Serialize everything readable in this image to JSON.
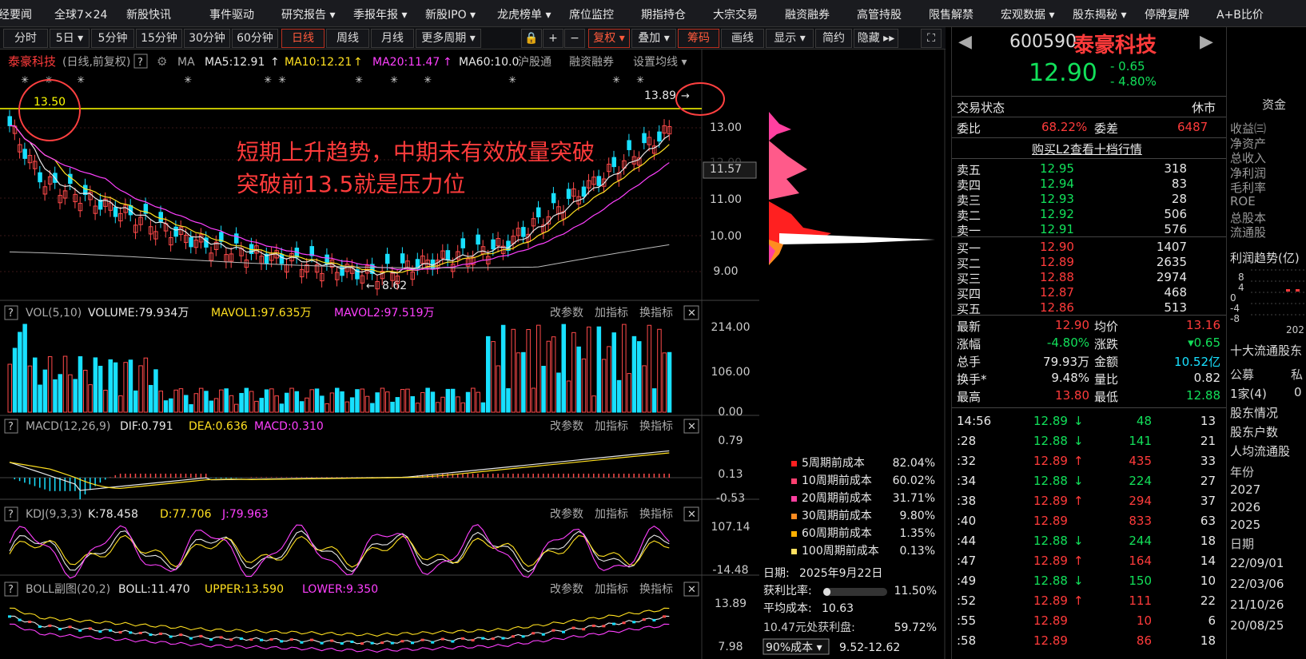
{
  "top_nav": [
    "经要闻",
    "全球7×24",
    "新股快讯",
    "事件驱动",
    "研究报告 ▾",
    "季报年报 ▾",
    "新股IPO ▾",
    "龙虎榜单 ▾",
    "席位监控",
    "期指持仓",
    "大宗交易",
    "融资融券",
    "高管持股",
    "限售解禁",
    "宏观数据 ▾",
    "股东揭秘 ▾",
    "停牌复牌",
    "A+B比价"
  ],
  "toolbar": {
    "periods": [
      "分时",
      "5日 ▾",
      "5分钟",
      "15分钟",
      "30分钟",
      "60分钟",
      "日线",
      "周线",
      "月线",
      "更多周期 ▾"
    ],
    "active_period": "日线",
    "tools": [
      "复权 ▾",
      "叠加 ▾",
      "筹码",
      "画线",
      "显示 ▾",
      "简约",
      "隐藏 ▸▸"
    ]
  },
  "stock": {
    "code": "600590",
    "name": "泰豪科技",
    "price": "12.90",
    "change": "- 0.65",
    "pct": "- 4.80%"
  },
  "main_chart": {
    "title": "泰豪科技",
    "subtitle": "(日线,前复权)",
    "q": "?",
    "ma_label": "MA",
    "ma5": "MA5:12.91",
    "ma10": "MA10:12.21",
    "ma20": "MA20:11.47",
    "ma60": "MA60:10.0",
    "links": [
      "沪股通",
      "融资融券",
      "设置均线 ▾"
    ],
    "price_ticks": [
      "13.00",
      "12.00",
      "11.57",
      "11.00",
      "10.00",
      "9.00"
    ],
    "label_1350": "13.50",
    "label_1389": "13.89",
    "label_862": "8.62",
    "annotation_line1": "短期上升趋势，中期未有效放量突破",
    "annotation_line2": "突破前13.5就是压力位"
  },
  "panels": {
    "vol": {
      "q": "?",
      "name": "VOL(5,10)",
      "v1": "VOLUME:79.934万",
      "v2": "MAVOL1:97.635万",
      "v3": "MAVOL2:97.519万",
      "ticks": [
        "214.00",
        "106.00",
        "0.00"
      ]
    },
    "macd": {
      "q": "?",
      "name": "MACD(12,26,9)",
      "v1": "DIF:0.791",
      "v2": "DEA:0.636",
      "v3": "MACD:0.310",
      "ticks": [
        "0.79",
        "0.13",
        "-0.53"
      ]
    },
    "kdj": {
      "q": "?",
      "name": "KDJ(9,3,3)",
      "v1": "K:78.458",
      "v2": "D:77.706",
      "v3": "J:79.963",
      "ticks": [
        "107.14",
        "-14.48"
      ]
    },
    "boll": {
      "q": "?",
      "name": "BOLL副图(20,2)",
      "v1": "BOLL:11.470",
      "v2": "UPPER:13.590",
      "v3": "LOWER:9.350",
      "ticks": [
        "13.89",
        "7.98"
      ]
    },
    "panel_buttons": [
      "改参数",
      "加指标",
      "换指标"
    ],
    "close": "✕"
  },
  "chip_dist": {
    "legend": [
      {
        "label": "5周期前成本",
        "value": "82.04%",
        "color": "#ff2020"
      },
      {
        "label": "10周期前成本",
        "value": "60.02%",
        "color": "#ff4070"
      },
      {
        "label": "20周期前成本",
        "value": "31.71%",
        "color": "#ff40a0"
      },
      {
        "label": "30周期前成本",
        "value": "9.80%",
        "color": "#ff8c20"
      },
      {
        "label": "60周期前成本",
        "value": "1.35%",
        "color": "#ffb000"
      },
      {
        "label": "100周期前成本",
        "value": "0.13%",
        "color": "#ffe060"
      }
    ],
    "date_label": "日期:",
    "date": "2025年9月22日",
    "profit_label": "获利比率:",
    "profit": "11.50%",
    "profit_fill": 0.115,
    "avg_cost_label": "平均成本:",
    "avg_cost": "10.63",
    "cost_line": "10.47元处获利盘:",
    "cost_pct": "59.72%",
    "range_select": "90%成本 ▾",
    "range": "9.52-12.62"
  },
  "quote": {
    "status_label": "交易状态",
    "status": "休市",
    "wb_label": "委比",
    "wb": "68.22%",
    "wc_label": "委差",
    "wc": "6487",
    "l2_link": "购买L2查看十档行情",
    "asks": [
      [
        "卖五",
        "12.95",
        "318"
      ],
      [
        "卖四",
        "12.94",
        "83"
      ],
      [
        "卖三",
        "12.93",
        "28"
      ],
      [
        "卖二",
        "12.92",
        "506"
      ],
      [
        "卖一",
        "12.91",
        "576"
      ]
    ],
    "bids": [
      [
        "买一",
        "12.90",
        "1407"
      ],
      [
        "买二",
        "12.89",
        "2635"
      ],
      [
        "买三",
        "12.88",
        "2974"
      ],
      [
        "买四",
        "12.87",
        "468"
      ],
      [
        "买五",
        "12.86",
        "513"
      ]
    ],
    "stats": [
      [
        {
          "l": "最新",
          "v": "12.90",
          "c": "red"
        },
        {
          "l": "均价",
          "v": "13.16",
          "c": "red"
        }
      ],
      [
        {
          "l": "涨幅",
          "v": "-4.80%",
          "c": "grn"
        },
        {
          "l": "涨跌",
          "v": "▾0.65",
          "c": "grn"
        }
      ],
      [
        {
          "l": "总手",
          "v": "79.93万",
          "c": "wht"
        },
        {
          "l": "金额",
          "v": "10.52亿",
          "c": "cyan"
        }
      ],
      [
        {
          "l": "换手*",
          "v": "9.48%",
          "c": "wht"
        },
        {
          "l": "量比",
          "v": "0.82",
          "c": "wht"
        }
      ],
      [
        {
          "l": "最高",
          "v": "13.80",
          "c": "red"
        },
        {
          "l": "最低",
          "v": "12.88",
          "c": "grn"
        }
      ]
    ],
    "ticks": [
      {
        "t": "14:56",
        "p": "12.89",
        "a": "↓",
        "v": "48",
        "n": "13",
        "c": "grn"
      },
      {
        "t": ":28",
        "p": "12.88",
        "a": "↓",
        "v": "141",
        "n": "21",
        "c": "grn"
      },
      {
        "t": ":32",
        "p": "12.89",
        "a": "↑",
        "v": "435",
        "n": "33",
        "c": "red"
      },
      {
        "t": ":34",
        "p": "12.88",
        "a": "↓",
        "v": "224",
        "n": "27",
        "c": "grn"
      },
      {
        "t": ":38",
        "p": "12.89",
        "a": "↑",
        "v": "294",
        "n": "37",
        "c": "red"
      },
      {
        "t": ":40",
        "p": "12.89",
        "a": "",
        "v": "833",
        "n": "63",
        "c": "red"
      },
      {
        "t": ":44",
        "p": "12.88",
        "a": "↓",
        "v": "244",
        "n": "18",
        "c": "grn"
      },
      {
        "t": ":47",
        "p": "12.89",
        "a": "↑",
        "v": "164",
        "n": "14",
        "c": "red"
      },
      {
        "t": ":49",
        "p": "12.88",
        "a": "↓",
        "v": "150",
        "n": "10",
        "c": "grn"
      },
      {
        "t": ":52",
        "p": "12.89",
        "a": "↑",
        "v": "111",
        "n": "22",
        "c": "red"
      },
      {
        "t": ":55",
        "p": "12.89",
        "a": "",
        "v": "10",
        "n": "6",
        "c": "red"
      },
      {
        "t": ":58",
        "p": "12.89",
        "a": "",
        "v": "86",
        "n": "18",
        "c": "red"
      }
    ]
  },
  "far_right": {
    "fund_tab": "资金",
    "items": [
      "收益㈢",
      "净资产",
      "总收入",
      "净利润",
      "毛利率",
      "ROE",
      "总股本",
      "流通股"
    ],
    "profit_trend": "利润趋势(亿)",
    "axis": [
      "8",
      "4",
      "0",
      "-4",
      "-8"
    ],
    "year_tail": "202",
    "top10": "十大流通股东",
    "holder_cols": [
      "公募",
      "私"
    ],
    "holder_val": "1家(4)",
    "holder_val2": "0",
    "links": [
      "股东情况",
      "股东户数",
      "人均流通股"
    ],
    "year_label": "年份",
    "years": [
      "2027",
      "2026",
      "2025"
    ],
    "date_label": "日期",
    "dates": [
      "22/09/01",
      "22/03/06",
      "21/10/26",
      "20/08/25"
    ]
  }
}
